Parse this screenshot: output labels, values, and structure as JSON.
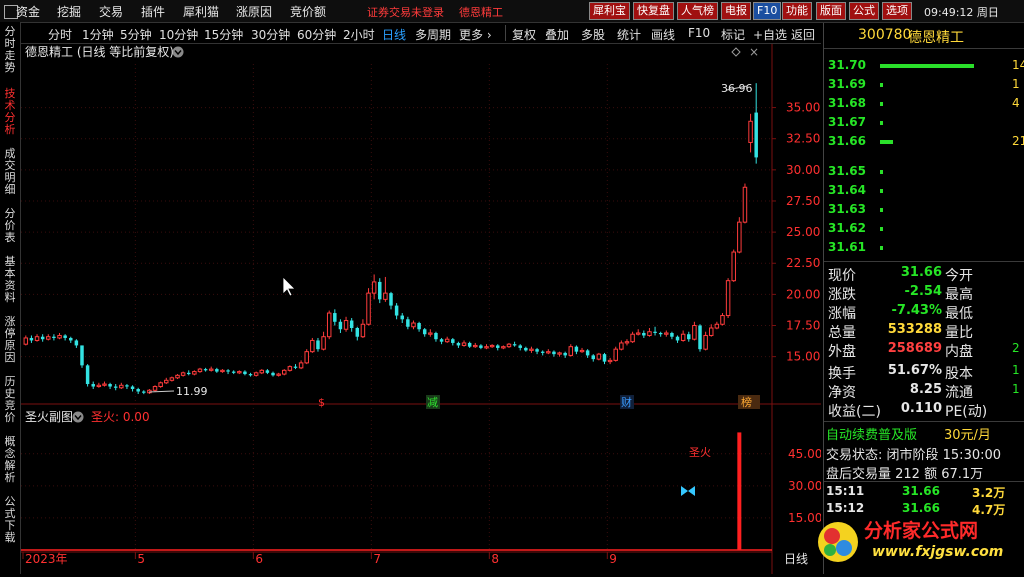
{
  "menu": {
    "items": [
      "资金",
      "挖掘",
      "交易",
      "插件",
      "犀利猫",
      "涨原因",
      "竞价额"
    ],
    "status_notice": "证券交易未登录",
    "stock_name_top": "德恩精工",
    "tool_buttons": [
      "犀利宝",
      "快复盘",
      "人气榜",
      "电报",
      "F10",
      "功能",
      "版面",
      "公式",
      "选项"
    ],
    "clock": "09:49:12 周日"
  },
  "left_tabs": [
    "分时走势",
    "技术分析",
    "成交明细",
    "分价表",
    "基本资料",
    "涨停原因",
    "历史竞价",
    "概念解析",
    "公式下载"
  ],
  "period_bar": {
    "periods": [
      "分时",
      "1分钟",
      "5分钟",
      "10分钟",
      "15分钟",
      "30分钟",
      "60分钟",
      "2小时",
      "日线",
      "多周期",
      "更多 ›"
    ],
    "active": "日线",
    "actions": [
      "复权",
      "叠加",
      "多股",
      "统计",
      "画线",
      "F10",
      "标记",
      "+自选",
      "返回"
    ]
  },
  "chart_title": "德恩精工 (日线 等比前复权)",
  "sub_title": "圣火副图",
  "sub_value": "圣火: 0.00",
  "sub_signal_label": "圣火",
  "chart_data": {
    "type": "candlestick",
    "y_ticks": [
      15.0,
      17.5,
      20.0,
      22.5,
      25.0,
      27.5,
      30.0,
      32.5,
      35.0
    ],
    "ylim": [
      12.0,
      38.5
    ],
    "high_label": "36.96",
    "low_label": "11.99",
    "sub_y_ticks": [
      15.0,
      30.0,
      45.0
    ],
    "sub_ylim": [
      0,
      58
    ],
    "x_labels": [
      "2023年",
      "5",
      "6",
      "7",
      "8",
      "9"
    ],
    "period_label": "日线",
    "event_markers": [
      "$",
      "减",
      "财",
      "榜"
    ],
    "candles": [
      [
        16.0,
        16.5,
        16.7,
        15.9
      ],
      [
        16.5,
        16.3,
        16.7,
        16.1
      ],
      [
        16.3,
        16.6,
        16.8,
        16.2
      ],
      [
        16.6,
        16.4,
        16.8,
        16.2
      ],
      [
        16.4,
        16.6,
        16.8,
        16.3
      ],
      [
        16.6,
        16.5,
        16.8,
        16.3
      ],
      [
        16.5,
        16.7,
        16.9,
        16.4
      ],
      [
        16.7,
        16.5,
        16.8,
        16.3
      ],
      [
        16.5,
        16.3,
        16.6,
        16.1
      ],
      [
        16.3,
        15.9,
        16.4,
        15.7
      ],
      [
        15.9,
        14.3,
        15.9,
        14.1
      ],
      [
        14.3,
        12.8,
        14.4,
        12.6
      ],
      [
        12.8,
        12.6,
        13.0,
        12.4
      ],
      [
        12.6,
        12.7,
        12.9,
        12.5
      ],
      [
        12.7,
        12.8,
        13.0,
        12.6
      ],
      [
        12.8,
        12.6,
        12.9,
        12.4
      ],
      [
        12.6,
        12.5,
        12.8,
        12.3
      ],
      [
        12.5,
        12.7,
        12.9,
        12.4
      ],
      [
        12.7,
        12.6,
        12.8,
        12.4
      ],
      [
        12.6,
        12.4,
        12.7,
        12.2
      ],
      [
        12.4,
        12.2,
        12.5,
        12.0
      ],
      [
        12.2,
        12.1,
        12.3,
        11.99
      ],
      [
        12.1,
        12.3,
        12.4,
        12.0
      ],
      [
        12.3,
        12.6,
        12.7,
        12.2
      ],
      [
        12.6,
        12.9,
        13.0,
        12.5
      ],
      [
        12.9,
        13.1,
        13.3,
        12.8
      ],
      [
        13.1,
        13.3,
        13.4,
        13.0
      ],
      [
        13.3,
        13.5,
        13.6,
        13.2
      ],
      [
        13.5,
        13.7,
        13.8,
        13.4
      ],
      [
        13.7,
        13.6,
        13.9,
        13.5
      ],
      [
        13.6,
        13.8,
        13.9,
        13.5
      ],
      [
        13.8,
        14.0,
        14.1,
        13.7
      ],
      [
        14.0,
        13.9,
        14.1,
        13.8
      ],
      [
        13.9,
        14.0,
        14.2,
        13.8
      ],
      [
        14.0,
        13.8,
        14.1,
        13.7
      ],
      [
        13.8,
        13.9,
        14.0,
        13.7
      ],
      [
        13.9,
        13.8,
        14.0,
        13.6
      ],
      [
        13.8,
        13.7,
        13.9,
        13.6
      ],
      [
        13.7,
        13.8,
        13.9,
        13.6
      ],
      [
        13.8,
        13.6,
        13.9,
        13.5
      ],
      [
        13.6,
        13.5,
        13.7,
        13.4
      ],
      [
        13.5,
        13.7,
        13.8,
        13.4
      ],
      [
        13.7,
        13.9,
        14.0,
        13.6
      ],
      [
        13.9,
        13.7,
        14.0,
        13.6
      ],
      [
        13.7,
        13.5,
        13.8,
        13.4
      ],
      [
        13.5,
        13.6,
        13.7,
        13.4
      ],
      [
        13.6,
        13.9,
        14.0,
        13.5
      ],
      [
        13.9,
        14.2,
        14.3,
        13.8
      ],
      [
        14.2,
        14.1,
        14.4,
        14.0
      ],
      [
        14.1,
        14.5,
        14.7,
        14.0
      ],
      [
        14.5,
        15.4,
        15.6,
        14.4
      ],
      [
        15.4,
        16.3,
        16.5,
        15.3
      ],
      [
        16.3,
        15.6,
        16.5,
        15.4
      ],
      [
        15.6,
        16.6,
        17.0,
        15.5
      ],
      [
        16.6,
        18.5,
        18.7,
        16.4
      ],
      [
        18.5,
        17.8,
        18.8,
        17.5
      ],
      [
        17.8,
        17.2,
        18.0,
        16.9
      ],
      [
        17.2,
        17.9,
        18.2,
        17.0
      ],
      [
        17.9,
        17.3,
        18.1,
        17.0
      ],
      [
        17.3,
        16.6,
        17.4,
        16.3
      ],
      [
        16.6,
        17.6,
        18.0,
        16.5
      ],
      [
        17.6,
        20.1,
        20.5,
        17.5
      ],
      [
        20.1,
        21.0,
        21.6,
        19.6
      ],
      [
        21.0,
        19.6,
        21.3,
        19.3
      ],
      [
        19.6,
        20.1,
        21.4,
        19.4
      ],
      [
        20.1,
        19.1,
        20.2,
        18.8
      ],
      [
        19.1,
        18.3,
        19.3,
        18.0
      ],
      [
        18.3,
        18.0,
        18.5,
        17.7
      ],
      [
        18.0,
        17.4,
        18.2,
        17.2
      ],
      [
        17.4,
        17.7,
        17.9,
        17.2
      ],
      [
        17.7,
        17.2,
        17.8,
        17.0
      ],
      [
        17.2,
        16.8,
        17.3,
        16.6
      ],
      [
        16.8,
        16.9,
        17.2,
        16.6
      ],
      [
        16.9,
        16.4,
        17.0,
        16.2
      ],
      [
        16.4,
        16.2,
        16.5,
        16.0
      ],
      [
        16.2,
        16.4,
        16.6,
        16.1
      ],
      [
        16.4,
        16.1,
        16.5,
        15.9
      ],
      [
        16.1,
        15.9,
        16.2,
        15.7
      ],
      [
        15.9,
        16.1,
        16.3,
        15.8
      ],
      [
        16.1,
        15.8,
        16.2,
        15.7
      ],
      [
        15.8,
        15.9,
        16.1,
        15.7
      ],
      [
        15.9,
        15.7,
        16.0,
        15.6
      ],
      [
        15.7,
        15.8,
        16.0,
        15.6
      ],
      [
        15.8,
        15.9,
        16.0,
        15.7
      ],
      [
        15.9,
        15.7,
        16.0,
        15.5
      ],
      [
        15.7,
        15.8,
        15.9,
        15.6
      ],
      [
        15.8,
        16.0,
        16.1,
        15.7
      ],
      [
        16.0,
        15.9,
        16.2,
        15.8
      ],
      [
        15.9,
        15.7,
        16.0,
        15.5
      ],
      [
        15.7,
        15.5,
        15.8,
        15.4
      ],
      [
        15.5,
        15.6,
        15.8,
        15.3
      ],
      [
        15.6,
        15.4,
        15.7,
        15.2
      ],
      [
        15.4,
        15.3,
        15.5,
        15.1
      ],
      [
        15.3,
        15.4,
        15.6,
        15.2
      ],
      [
        15.4,
        15.2,
        15.5,
        15.0
      ],
      [
        15.2,
        15.3,
        15.4,
        15.0
      ],
      [
        15.3,
        15.1,
        15.4,
        14.9
      ],
      [
        15.1,
        15.8,
        16.0,
        15.0
      ],
      [
        15.8,
        15.4,
        15.9,
        15.2
      ],
      [
        15.4,
        15.5,
        15.7,
        15.3
      ],
      [
        15.5,
        15.1,
        15.6,
        14.9
      ],
      [
        15.1,
        14.8,
        15.2,
        14.6
      ],
      [
        14.8,
        15.2,
        15.3,
        14.7
      ],
      [
        15.2,
        14.6,
        15.3,
        14.4
      ],
      [
        14.6,
        14.7,
        14.9,
        14.4
      ],
      [
        14.7,
        15.6,
        15.8,
        14.6
      ],
      [
        15.6,
        16.1,
        16.3,
        15.5
      ],
      [
        16.1,
        16.2,
        16.4,
        15.9
      ],
      [
        16.2,
        16.8,
        17.0,
        16.1
      ],
      [
        16.8,
        16.9,
        17.2,
        16.7
      ],
      [
        16.9,
        16.7,
        17.1,
        16.5
      ],
      [
        16.7,
        17.0,
        17.3,
        16.6
      ],
      [
        17.0,
        16.9,
        17.4,
        16.7
      ],
      [
        16.9,
        16.8,
        17.0,
        16.6
      ],
      [
        16.8,
        16.9,
        17.1,
        16.6
      ],
      [
        16.9,
        16.6,
        17.0,
        16.4
      ],
      [
        16.6,
        16.3,
        16.7,
        16.1
      ],
      [
        16.3,
        16.8,
        17.1,
        16.2
      ],
      [
        16.8,
        16.4,
        17.0,
        16.2
      ],
      [
        16.4,
        17.5,
        17.8,
        16.3
      ],
      [
        17.5,
        15.6,
        17.6,
        15.4
      ],
      [
        15.6,
        16.7,
        17.0,
        15.5
      ],
      [
        16.7,
        17.3,
        17.6,
        16.6
      ],
      [
        17.3,
        17.6,
        17.8,
        17.2
      ],
      [
        17.6,
        18.3,
        18.5,
        17.5
      ],
      [
        18.3,
        21.1,
        21.3,
        18.1
      ],
      [
        21.1,
        23.4,
        23.6,
        21.0
      ],
      [
        23.4,
        25.8,
        26.2,
        23.3
      ],
      [
        25.8,
        28.6,
        28.9,
        25.7
      ],
      [
        32.2,
        33.9,
        34.5,
        31.4
      ],
      [
        34.6,
        31.0,
        36.96,
        30.5
      ]
    ],
    "sub_signal": {
      "index": 127,
      "value": 55
    }
  },
  "quote": {
    "code": "300780",
    "name": "德恩精工",
    "sell": [
      {
        "price": "31.70",
        "bar": 0.85,
        "vol": "14"
      },
      {
        "price": "31.69",
        "bar": 0.02,
        "vol": "1"
      },
      {
        "price": "31.68",
        "bar": 0.02,
        "vol": "4"
      },
      {
        "price": "31.67",
        "bar": 0.02,
        "vol": ""
      },
      {
        "price": "31.66",
        "bar": 0.12,
        "vol": "21"
      }
    ],
    "buy": [
      {
        "price": "31.65",
        "bar": 0.02,
        "vol": ""
      },
      {
        "price": "31.64",
        "bar": 0.02,
        "vol": ""
      },
      {
        "price": "31.63",
        "bar": 0.02,
        "vol": ""
      },
      {
        "price": "31.62",
        "bar": 0.02,
        "vol": ""
      },
      {
        "price": "31.61",
        "bar": 0.02,
        "vol": ""
      }
    ],
    "stats": [
      {
        "l1": "现价",
        "v1": "31.66",
        "c1": "g",
        "l2": "今开",
        "v2": ""
      },
      {
        "l1": "涨跌",
        "v1": "-2.54",
        "c1": "g",
        "l2": "最高",
        "v2": ""
      },
      {
        "l1": "涨幅",
        "v1": "-7.43%",
        "c1": "g",
        "l2": "最低",
        "v2": ""
      },
      {
        "l1": "总量",
        "v1": "533288",
        "c1": "y",
        "l2": "量比",
        "v2": ""
      },
      {
        "l1": "外盘",
        "v1": "258689",
        "c1": "r",
        "l2": "内盘",
        "v2": "2"
      }
    ],
    "stats2": [
      {
        "l1": "换手",
        "v1": "51.67%",
        "c1": "w",
        "l2": "股本",
        "v2": "1"
      },
      {
        "l1": "净资",
        "v1": "8.25",
        "c1": "w",
        "l2": "流通",
        "v2": "1"
      },
      {
        "l1": "收益(二)",
        "v1": "0.110",
        "c1": "w",
        "l2": "PE(动)",
        "v2": ""
      }
    ],
    "auto_fee": "自动续费普及版",
    "price_month": "30元/月",
    "trade_status": "交易状态: 闭市阶段 15:30:00",
    "after_hours": "盘后交易量 212 额 67.1万",
    "ticks": [
      {
        "time": "15:11",
        "price": "31.66",
        "vol": "3.2万"
      },
      {
        "time": "15:12",
        "price": "31.66",
        "vol": "4.7万"
      }
    ],
    "watermark_title": "分析家公式网",
    "watermark_url": "www.fxjgsw.com"
  }
}
